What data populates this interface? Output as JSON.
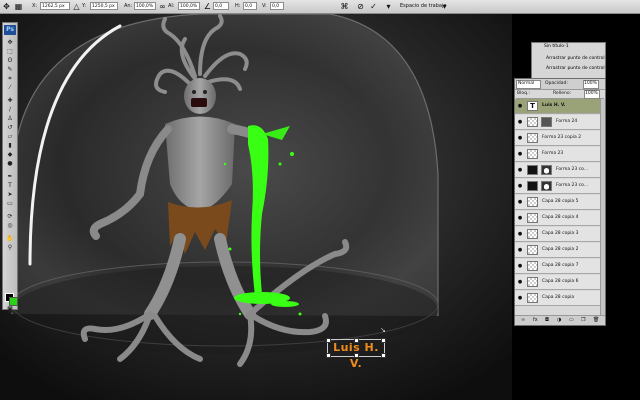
{
  "options_bar": {
    "x_label": "X:",
    "x_value": "1262,5 px",
    "y_label": "Y:",
    "y_value": "1250,5 px",
    "w_label": "An:",
    "w_value": "100,0%",
    "h_label": "Al:",
    "h_value": "100,0%",
    "angle_value": "0,0",
    "skew_h_label": "H:",
    "skew_h_value": "0,0",
    "skew_v_label": "V:",
    "skew_v_value": "0,0",
    "workspace_label": "Espacio de trabajo"
  },
  "toolbox": {
    "logo": "Ps"
  },
  "history_panel": {
    "title": "Sin título-1",
    "items": [
      "Arrastrar punto de control",
      "Arrastrar punto de control"
    ]
  },
  "layers_panel": {
    "blend_mode": "Normal",
    "opacity_label": "Opacidad:",
    "opacity_value": "100%",
    "lock_label": "Bloq.:",
    "fill_label": "Relleno:",
    "fill_value": "100%",
    "layers": [
      {
        "name": "Luis H. V.",
        "selected": true,
        "kind": "text"
      },
      {
        "name": "Forma 24",
        "selected": false,
        "kind": "shape"
      },
      {
        "name": "Forma 23 copia 2",
        "selected": false,
        "kind": "plain"
      },
      {
        "name": "Forma 23",
        "selected": false,
        "kind": "plain"
      },
      {
        "name": "Forma 23 co...",
        "selected": false,
        "kind": "dark"
      },
      {
        "name": "Forma 23 co...",
        "selected": false,
        "kind": "dark"
      },
      {
        "name": "Capa 28 copia 5",
        "selected": false,
        "kind": "plain"
      },
      {
        "name": "Capa 28 copia 4",
        "selected": false,
        "kind": "plain"
      },
      {
        "name": "Capa 28 copia 3",
        "selected": false,
        "kind": "plain"
      },
      {
        "name": "Capa 28 copia 2",
        "selected": false,
        "kind": "plain"
      },
      {
        "name": "Capa 28 copia 7",
        "selected": false,
        "kind": "plain"
      },
      {
        "name": "Capa 28 copia 6",
        "selected": false,
        "kind": "plain"
      },
      {
        "name": "Capa 28 copia",
        "selected": false,
        "kind": "plain"
      }
    ]
  },
  "signature": {
    "text": "Luis H. V."
  },
  "colors": {
    "foreground": "#000000",
    "background": "#27d511",
    "slime": "#39ff14",
    "signature": "#f08c1c",
    "selected_layer": "#9aa277"
  }
}
